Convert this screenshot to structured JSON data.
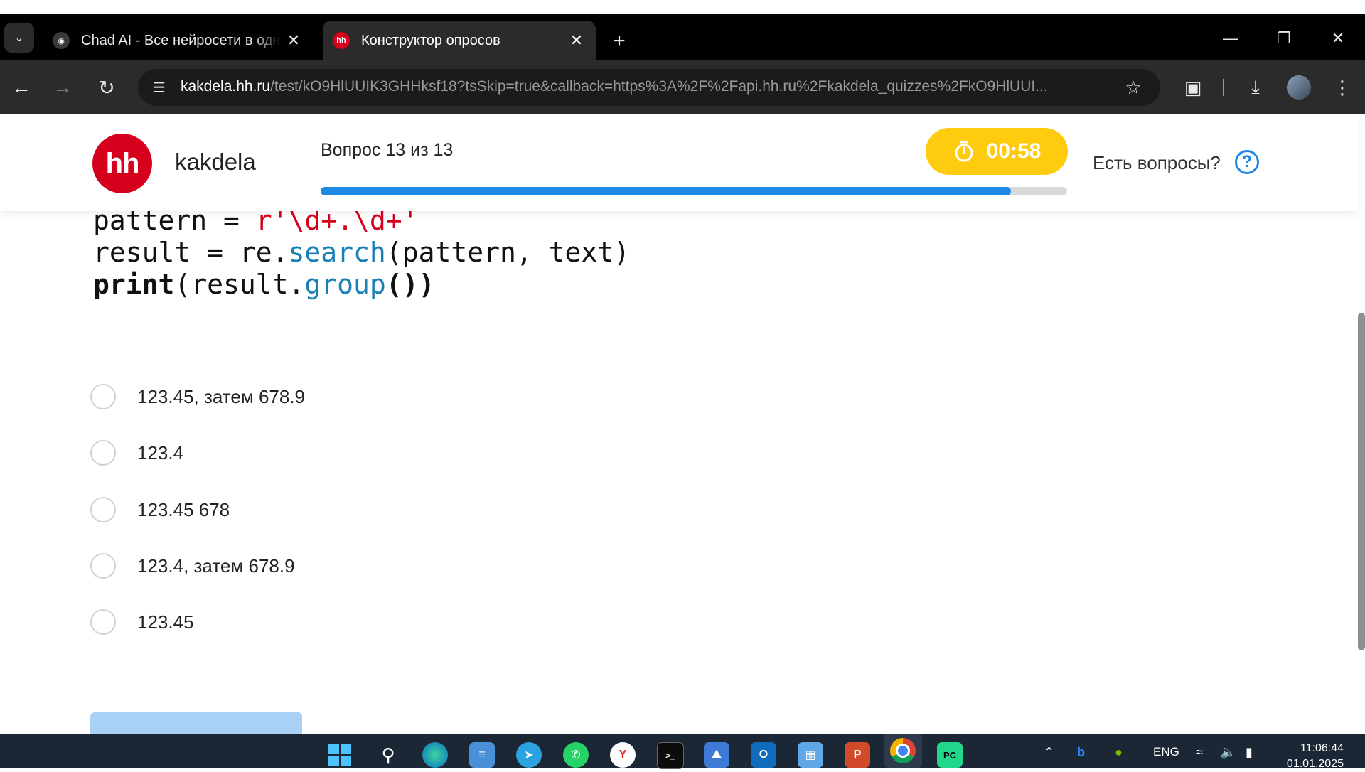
{
  "browser": {
    "tabs": [
      {
        "title": "Chad AI - Все нейросети в одном",
        "active": false
      },
      {
        "title": "Конструктор опросов",
        "active": true
      }
    ],
    "url_host": "kakdela.hh.ru",
    "url_path": "/test/kO9HlUUIK3GHHksf18?tsSkip=true&callback=https%3A%2F%2Fapi.hh.ru%2Fkakdela_quizzes%2FkO9HlUUI..."
  },
  "header": {
    "logo_text": "hh",
    "brand": "kakdela",
    "progress_text": "Вопрос 13 из 13",
    "progress_fraction": 0.925,
    "timer": "00:58",
    "help_text": "Есть вопросы?",
    "help_icon_label": "?"
  },
  "code_lines": {
    "line1_a": "pattern = ",
    "line1_b": "r'\\d+.\\d+'",
    "line2_a": "result = re.",
    "line2_b": "search",
    "line2_c": "(pattern, text)",
    "line3_a": "print",
    "line3_b": "(result.",
    "line3_c": "group",
    "line3_d": "())"
  },
  "options": [
    {
      "label": "123.45, затем 678.9"
    },
    {
      "label": "123.4"
    },
    {
      "label": "123.45 678"
    },
    {
      "label": "123.4, затем 678.9"
    },
    {
      "label": "123.45"
    }
  ],
  "taskbar": {
    "lang": "ENG",
    "time": "11:06:44",
    "date": "01.01.2025"
  },
  "colors": {
    "hh_red": "#d6001c",
    "progress_blue": "#1e88e5",
    "timer_yellow": "#ffcb0e",
    "submit_disabled": "#a9d1f5"
  }
}
